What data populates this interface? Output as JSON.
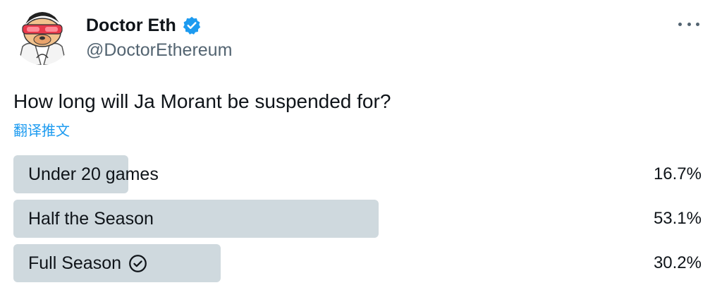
{
  "author": {
    "display_name": "Doctor Eth",
    "handle": "@DoctorEthereum",
    "verified": true,
    "avatar_icon": "cartoon-doctor-avatar-icon",
    "verified_icon": "verified-badge-icon",
    "more_icon": "more-options-icon"
  },
  "tweet": {
    "text": "How long will Ja Morant be suspended for?",
    "translate_label": "翻译推文"
  },
  "poll": {
    "options": [
      {
        "label": "Under 20 games",
        "percent_text": "16.7%",
        "percent": 16.7,
        "winner": false
      },
      {
        "label": "Half the Season",
        "percent_text": "53.1%",
        "percent": 53.1,
        "winner": false
      },
      {
        "label": "Full Season",
        "percent_text": "30.2%",
        "percent": 30.2,
        "winner": true
      }
    ]
  },
  "colors": {
    "accent": "#1d9bf0",
    "bar": "#cfd9de",
    "text": "#0f1419",
    "secondary": "#536471"
  }
}
